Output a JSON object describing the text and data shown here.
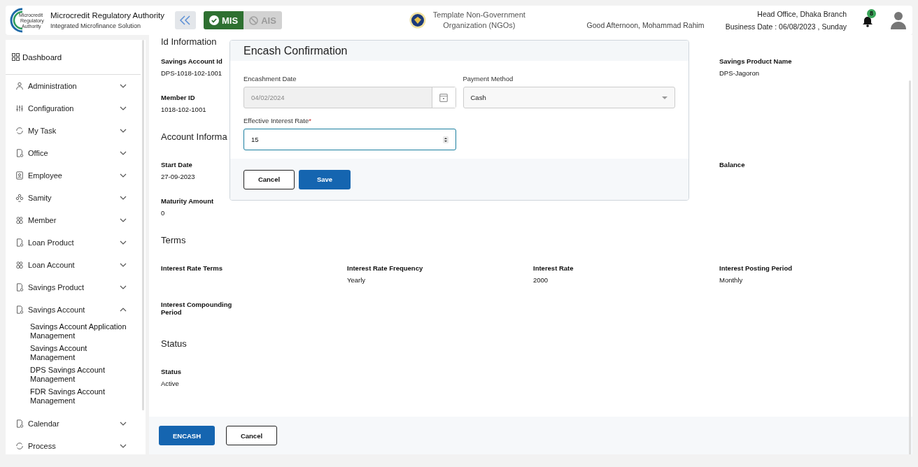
{
  "header": {
    "logo_lines": [
      "Microcredit",
      "Regulatory",
      "Authority"
    ],
    "app_title": "Microcredit Regulatory Authority",
    "app_subtitle": "Integrated Microfinance Solution",
    "modules": [
      {
        "label": "MIS",
        "selected": true
      },
      {
        "label": "AIS",
        "selected": false
      }
    ],
    "organization_lines": [
      "Template Non-Government",
      "Organization (NGOs)"
    ],
    "greeting": "Good Afternoon, Mohammad Rahim",
    "branch": "Head Office, Dhaka Branch",
    "business_date": "Business Date : 06/08/2023 , Sunday",
    "notification_count": "8"
  },
  "sidebar": {
    "dashboard": "Dashboard",
    "items": [
      {
        "label": "Administration",
        "expanded": false
      },
      {
        "label": "Configuration",
        "expanded": false
      },
      {
        "label": "My Task",
        "expanded": false
      },
      {
        "label": "Office",
        "expanded": false
      },
      {
        "label": "Employee",
        "expanded": false
      },
      {
        "label": "Samity",
        "expanded": false
      },
      {
        "label": "Member",
        "expanded": false
      },
      {
        "label": "Loan Product",
        "expanded": false
      },
      {
        "label": "Loan Account",
        "expanded": false
      },
      {
        "label": "Savings Product",
        "expanded": false
      },
      {
        "label": "Savings Account",
        "expanded": true,
        "children": [
          "Savings Account Application Management",
          "Savings Account Management",
          "DPS Savings Account Management",
          "FDR Savings Account Management"
        ]
      },
      {
        "label": "Calendar",
        "expanded": false
      },
      {
        "label": "Process",
        "expanded": false
      }
    ]
  },
  "details": {
    "sections": [
      {
        "title": "Id Information",
        "rows": [
          [
            {
              "label": "Savings Account Id",
              "value": "DPS-1018-102-1001"
            },
            null,
            null,
            {
              "label": "Savings Product Name",
              "value": "DPS-Jagoron"
            }
          ],
          [
            {
              "label": "Member ID",
              "value": "1018-102-1001"
            }
          ]
        ]
      },
      {
        "title": "Account Informa",
        "rows": [
          [
            {
              "label": "Start Date",
              "value": "27-09-2023"
            },
            null,
            null,
            {
              "label": "Balance"
            }
          ],
          [
            {
              "label": "Maturity Amount",
              "value": "0"
            }
          ]
        ]
      },
      {
        "title": "Terms",
        "rows": [
          [
            {
              "label": "Interest Rate Terms"
            },
            {
              "label": "Interest Rate Frequency",
              "value": "Yearly"
            },
            {
              "label": "Interest Rate",
              "value": "2000"
            },
            {
              "label": "Interest Posting Period",
              "value": "Monthly"
            }
          ],
          [
            {
              "label": "Interest Compounding Period"
            }
          ]
        ]
      },
      {
        "title": "Status",
        "rows": [
          [
            {
              "label": "Status",
              "value": "Active"
            }
          ]
        ]
      }
    ],
    "buttons": [
      "ENCASH",
      "Cancel"
    ]
  },
  "modal": {
    "title": "Encash Confirmation",
    "encashment_date": {
      "label": "Encashment Date",
      "value": "04/02/2024",
      "disabled": true
    },
    "payment_method": {
      "label": "Payment Method",
      "value": "Cash"
    },
    "interest_rate": {
      "label": "Effective Interest Rate",
      "required": true,
      "required_mark": "*",
      "value": "15",
      "focused": true
    },
    "buttons": [
      "Cancel",
      "Save"
    ]
  }
}
